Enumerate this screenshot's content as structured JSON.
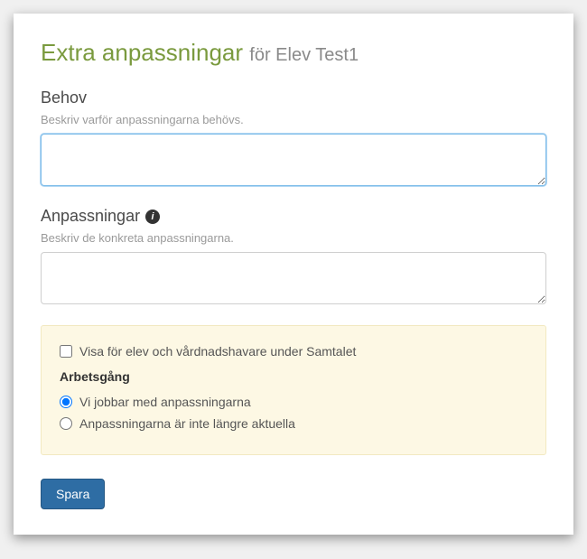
{
  "title": {
    "main": "Extra anpassningar",
    "sub": "för Elev Test1"
  },
  "behov": {
    "label": "Behov",
    "hint": "Beskriv varför anpassningarna behövs.",
    "value": ""
  },
  "anpassningar": {
    "label": "Anpassningar",
    "hint": "Beskriv de konkreta anpassningarna.",
    "value": ""
  },
  "options": {
    "visibility_label": "Visa för elev och vårdnadshavare under Samtalet",
    "visibility_checked": false,
    "workflow_heading": "Arbetsgång",
    "radios": [
      {
        "label": "Vi jobbar med anpassningarna",
        "checked": true
      },
      {
        "label": "Anpassningarna är inte längre aktuella",
        "checked": false
      }
    ]
  },
  "buttons": {
    "save": "Spara"
  },
  "icons": {
    "info_glyph": "i"
  }
}
